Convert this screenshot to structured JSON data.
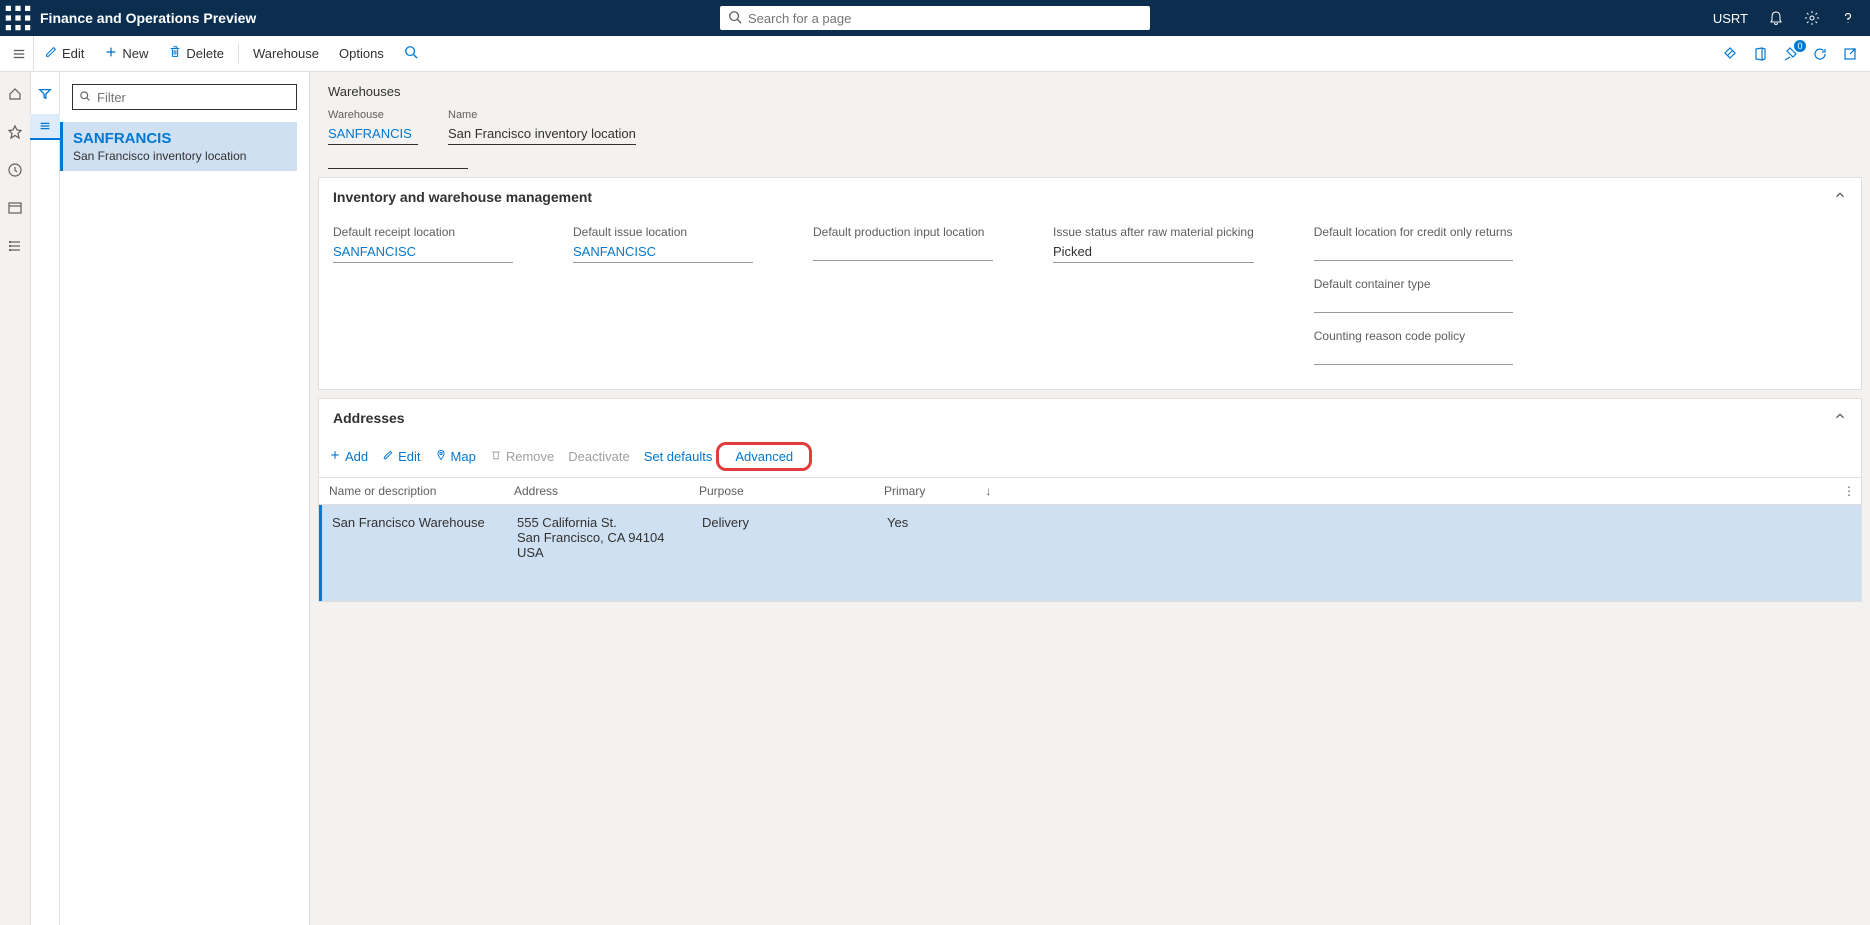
{
  "topbar": {
    "title": "Finance and Operations Preview",
    "search_placeholder": "Search for a page",
    "company": "USRT"
  },
  "actionbar": {
    "edit": "Edit",
    "new": "New",
    "delete": "Delete",
    "warehouse": "Warehouse",
    "options": "Options",
    "badge_count": "0"
  },
  "list": {
    "filter_placeholder": "Filter",
    "item": {
      "code": "SANFRANCIS",
      "desc": "San Francisco inventory location"
    }
  },
  "detail": {
    "breadcrumb": "Warehouses",
    "warehouse_label": "Warehouse",
    "warehouse_value": "SANFRANCIS",
    "name_label": "Name",
    "name_value": "San Francisco inventory location"
  },
  "inv": {
    "title": "Inventory and warehouse management",
    "receipt_label": "Default receipt location",
    "receipt_value": "SANFANCISC",
    "issue_label": "Default issue location",
    "issue_value": "SANFANCISC",
    "prod_label": "Default production input location",
    "prod_value": "",
    "status_label": "Issue status after raw material picking",
    "status_value": "Picked",
    "credit_label": "Default location for credit only returns",
    "credit_value": "",
    "container_label": "Default container type",
    "container_value": "",
    "reason_label": "Counting reason code policy",
    "reason_value": ""
  },
  "addr": {
    "title": "Addresses",
    "add": "Add",
    "edit": "Edit",
    "map": "Map",
    "remove": "Remove",
    "deactivate": "Deactivate",
    "setdefaults": "Set defaults",
    "advanced": "Advanced",
    "cols": {
      "name": "Name or description",
      "address": "Address",
      "purpose": "Purpose",
      "primary": "Primary"
    },
    "row": {
      "name": "San Francisco Warehouse",
      "address": "555 California St.\nSan Francisco, CA 94104\nUSA",
      "purpose": "Delivery",
      "primary": "Yes"
    }
  }
}
